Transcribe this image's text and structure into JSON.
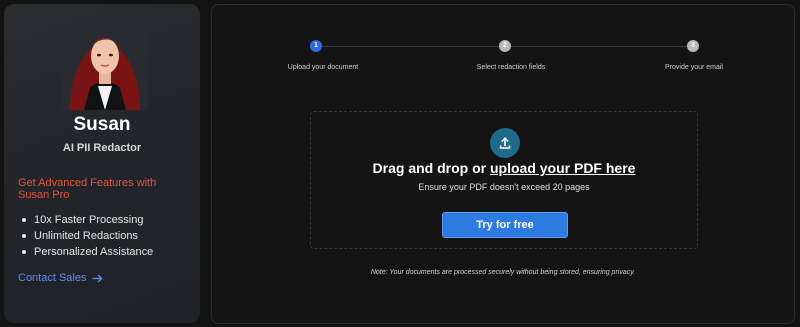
{
  "profile": {
    "name": "Susan",
    "role": "AI PII Redactor"
  },
  "promo": {
    "heading": "Get Advanced Features with Susan Pro",
    "features": [
      "10x Faster Processing",
      "Unlimited Redactions",
      "Personalized Assistance"
    ],
    "contact_label": "Contact Sales"
  },
  "stepper": {
    "steps": [
      {
        "number": "1",
        "label": "Upload your document",
        "active": true
      },
      {
        "number": "2",
        "label": "Select redaction fields",
        "active": false
      },
      {
        "number": "3",
        "label": "Provide your email",
        "active": false
      }
    ]
  },
  "upload": {
    "title_prefix": "Drag and drop or ",
    "title_link": "upload your PDF here",
    "subtitle": "Ensure your PDF doesn't exceed 20 pages",
    "button_label": "Try for free"
  },
  "note": "Note: Your documents are processed securely without being stored, ensuring privacy.",
  "colors": {
    "accent": "#2d7be0",
    "promo": "#e2553b",
    "link": "#5c8ef0",
    "upload_icon_bg": "#1d6a8a"
  },
  "icons": {
    "upload": "upload-arrow-icon",
    "contact_arrow": "arrow-right-icon"
  }
}
